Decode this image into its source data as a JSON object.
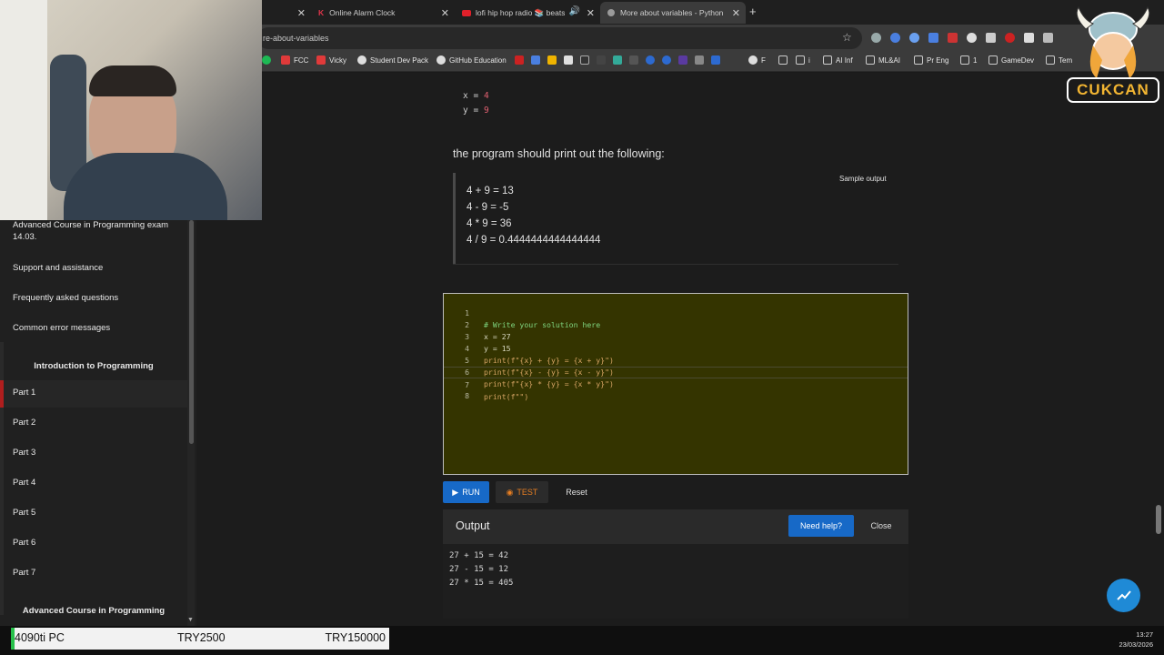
{
  "tabs": [
    {
      "label": "",
      "active": false
    },
    {
      "label": "Online Alarm Clock",
      "active": false
    },
    {
      "label": "lofi hip hop radio 📚 beats",
      "active": false
    },
    {
      "label": "More about variables - Python",
      "active": true
    }
  ],
  "url": "re-about-variables",
  "bookmarks": [
    "FCC",
    "Vicky",
    "Student Dev Pack",
    "GitHub Education",
    "F",
    "i",
    "AI Inf",
    "ML&AI",
    "Pr Eng",
    "1",
    "GameDev",
    "Tem"
  ],
  "sidebar": {
    "items_top": [
      "Advanced Course in Programming exam 14.03.",
      "Support and assistance",
      "Frequently asked questions",
      "Common error messages"
    ],
    "section1": "Introduction to Programming",
    "parts": [
      "Part 1",
      "Part 2",
      "Part 3",
      "Part 4",
      "Part 5",
      "Part 6",
      "Part 7"
    ],
    "section2": "Advanced Course in Programming"
  },
  "content": {
    "x_line": {
      "name": "x",
      "eq": "=",
      "val": "4"
    },
    "y_line": {
      "name": "y",
      "eq": "=",
      "val": "9"
    },
    "prose": "the program should print out the following:",
    "sample_label": "Sample output",
    "sample_lines": [
      "4 + 9 = 13",
      "4 - 9 = -5",
      "4 * 9 = 36",
      "4 / 9 = 0.4444444444444444"
    ]
  },
  "editor": {
    "line_numbers": [
      "1",
      "2",
      "3",
      "4",
      "5",
      "6",
      "7",
      "8"
    ],
    "lines": [
      "# Write your solution here",
      "x = 27",
      "y = 15",
      "print(f\"{x} + {y} = {x + y}\")",
      "print(f\"{x} - {y} = {x - y}\")",
      "print(f\"{x} * {y} = {x * y}\")",
      "print(f\"\")",
      ""
    ]
  },
  "buttons": {
    "run": "RUN",
    "test": "TEST",
    "reset": "Reset",
    "help": "Need help?",
    "close": "Close"
  },
  "output": {
    "title": "Output",
    "lines": [
      "27 + 15 = 42",
      "27 - 15 = 12",
      "27 * 15 = 405"
    ]
  },
  "logo_text": "CUKCAN",
  "ticker": {
    "item": "4090ti PC",
    "price1": "TRY2500",
    "price2": "TRY150000"
  },
  "clock": {
    "time": "13:27",
    "date": "23/03/2026"
  },
  "colors": {
    "accent": "#1769c7",
    "editor_bg": "#343400",
    "test": "#e67e22",
    "ticker_bar": "#27c04a"
  }
}
